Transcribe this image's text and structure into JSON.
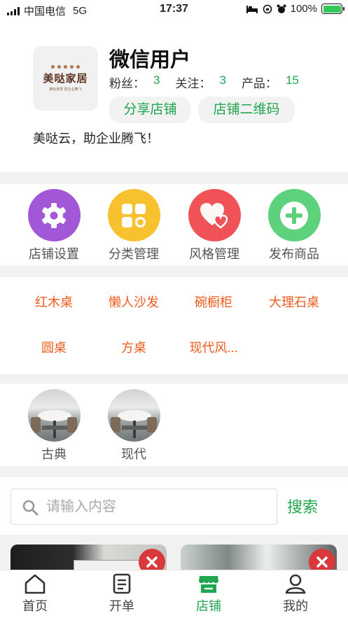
{
  "status": {
    "carrier": "中国电信",
    "network": "5G",
    "time": "17:37",
    "battery": "100%"
  },
  "profile": {
    "logo_text": "美哒家居",
    "logo_sub": "美哒家居 助企业腾飞",
    "name": "微信用户",
    "fans_label": "粉丝：",
    "fans": "3",
    "follow_label": "关注：",
    "follow": "3",
    "products_label": "产品：",
    "products": "15",
    "share_button": "分享店铺",
    "qr_button": "店铺二维码",
    "slogan": "美哒云，助企业腾飞！"
  },
  "tools": [
    {
      "label": "店铺设置",
      "icon": "gear-icon",
      "color": "#a258d6"
    },
    {
      "label": "分类管理",
      "icon": "category-icon",
      "color": "#f7c12f"
    },
    {
      "label": "风格管理",
      "icon": "heart-icon",
      "color": "#ef5257"
    },
    {
      "label": "发布商品",
      "icon": "plus-icon",
      "color": "#5dd17b"
    }
  ],
  "categories": [
    "红木桌",
    "懒人沙发",
    "碗橱柜",
    "大理石桌",
    "圆桌",
    "方桌",
    "现代风..."
  ],
  "styles": [
    {
      "label": "古典"
    },
    {
      "label": "现代"
    }
  ],
  "search": {
    "placeholder": "请输入内容",
    "button": "搜索"
  },
  "tabs": [
    {
      "label": "首页",
      "icon": "home-icon"
    },
    {
      "label": "开单",
      "icon": "order-icon"
    },
    {
      "label": "店铺",
      "icon": "shop-icon"
    },
    {
      "label": "我的",
      "icon": "user-icon"
    }
  ],
  "colors": {
    "accent": "#1fa64f",
    "category_text": "#f05a1c",
    "delete": "#d9383d"
  }
}
